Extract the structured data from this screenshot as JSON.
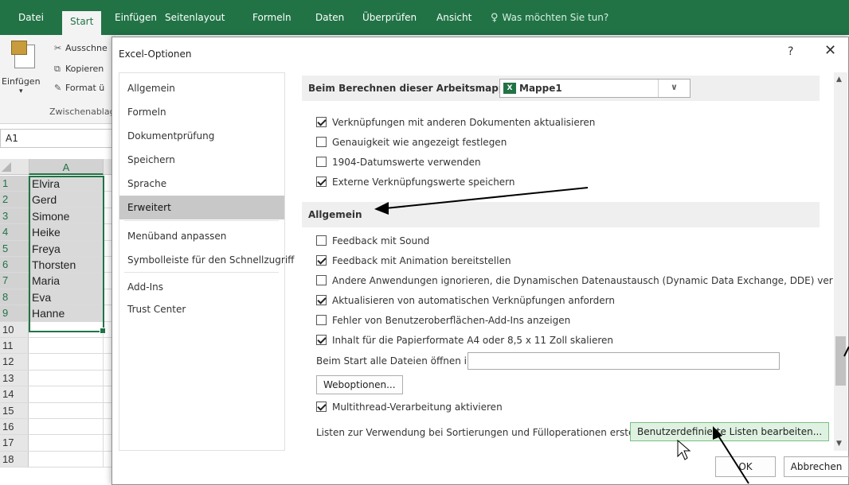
{
  "ribbon_tabs": [
    {
      "label": "Datei"
    },
    {
      "label": "Start"
    },
    {
      "label": "Einfügen"
    },
    {
      "label": "Seitenlayout"
    },
    {
      "label": "Formeln"
    },
    {
      "label": "Daten"
    },
    {
      "label": "Überprüfen"
    },
    {
      "label": "Ansicht"
    }
  ],
  "tell_me": "Was möchten Sie tun?",
  "ribbon": {
    "paste_label": "Einfügen",
    "cut_label": "Ausschne",
    "copy_label": "Kopieren",
    "format_label": "Format ü",
    "group_label": "Zwischenablage"
  },
  "namebox": "A1",
  "column_header": "A",
  "rows": [
    {
      "num": "1",
      "value": "Elvira"
    },
    {
      "num": "2",
      "value": "Gerd"
    },
    {
      "num": "3",
      "value": "Simone"
    },
    {
      "num": "4",
      "value": "Heike"
    },
    {
      "num": "5",
      "value": "Freya"
    },
    {
      "num": "6",
      "value": "Thorsten"
    },
    {
      "num": "7",
      "value": "Maria"
    },
    {
      "num": "8",
      "value": "Eva"
    },
    {
      "num": "9",
      "value": "Hanne"
    },
    {
      "num": "10",
      "value": ""
    },
    {
      "num": "11",
      "value": ""
    },
    {
      "num": "12",
      "value": ""
    },
    {
      "num": "13",
      "value": ""
    },
    {
      "num": "14",
      "value": ""
    },
    {
      "num": "15",
      "value": ""
    },
    {
      "num": "16",
      "value": ""
    },
    {
      "num": "17",
      "value": ""
    },
    {
      "num": "18",
      "value": ""
    }
  ],
  "dialog": {
    "title": "Excel-Optionen",
    "help": "?",
    "close": "✕",
    "nav": [
      {
        "label": "Allgemein"
      },
      {
        "label": "Formeln"
      },
      {
        "label": "Dokumentprüfung"
      },
      {
        "label": "Speichern"
      },
      {
        "label": "Sprache"
      },
      {
        "label": "Erweitert"
      },
      {
        "label": "Menüband anpassen"
      },
      {
        "label": "Symbolleiste für den Schnellzugriff"
      },
      {
        "label": "Add-Ins"
      },
      {
        "label": "Trust Center"
      }
    ],
    "calc_section": {
      "label": "Beim Berechnen dieser Arbeitsmappe:",
      "workbook": "Mappe1",
      "workbook_icon": "excel-icon"
    },
    "calc_options": [
      {
        "label": "Verknüpfungen mit anderen Dokumenten aktualisieren",
        "checked": true
      },
      {
        "label": "Genauigkeit wie angezeigt festlegen",
        "checked": false
      },
      {
        "label": "1904-Datumswerte verwenden",
        "checked": false
      },
      {
        "label": "Externe Verknüpfungswerte speichern",
        "checked": true
      }
    ],
    "general_section": "Allgemein",
    "general_options": [
      {
        "label": "Feedback mit Sound",
        "checked": false
      },
      {
        "label": "Feedback mit Animation bereitstellen",
        "checked": true
      },
      {
        "label": "Andere Anwendungen ignorieren, die Dynamischen Datenaustausch (Dynamic Data Exchange, DDE) verwenden",
        "checked": false
      },
      {
        "label": "Aktualisieren von automatischen Verknüpfungen anfordern",
        "checked": true
      },
      {
        "label": "Fehler von Benutzeroberflächen-Add-Ins anzeigen",
        "checked": false
      },
      {
        "label": "Inhalt für die Papierformate A4 oder 8,5 x 11 Zoll skalieren",
        "checked": true
      }
    ],
    "start_files_label": "Beim Start alle Dateien öffnen in:",
    "start_files_value": "",
    "web_options_button": "Weboptionen...",
    "multithread": {
      "label": "Multithread-Verarbeitung aktivieren",
      "checked": true
    },
    "custom_lists_label": "Listen zur Verwendung bei Sortierungen und Fülloperationen erstellen:",
    "custom_lists_button": "Benutzerdefinierte Listen bearbeiten...",
    "ok_button": "OK",
    "cancel_button": "Abbrechen"
  }
}
